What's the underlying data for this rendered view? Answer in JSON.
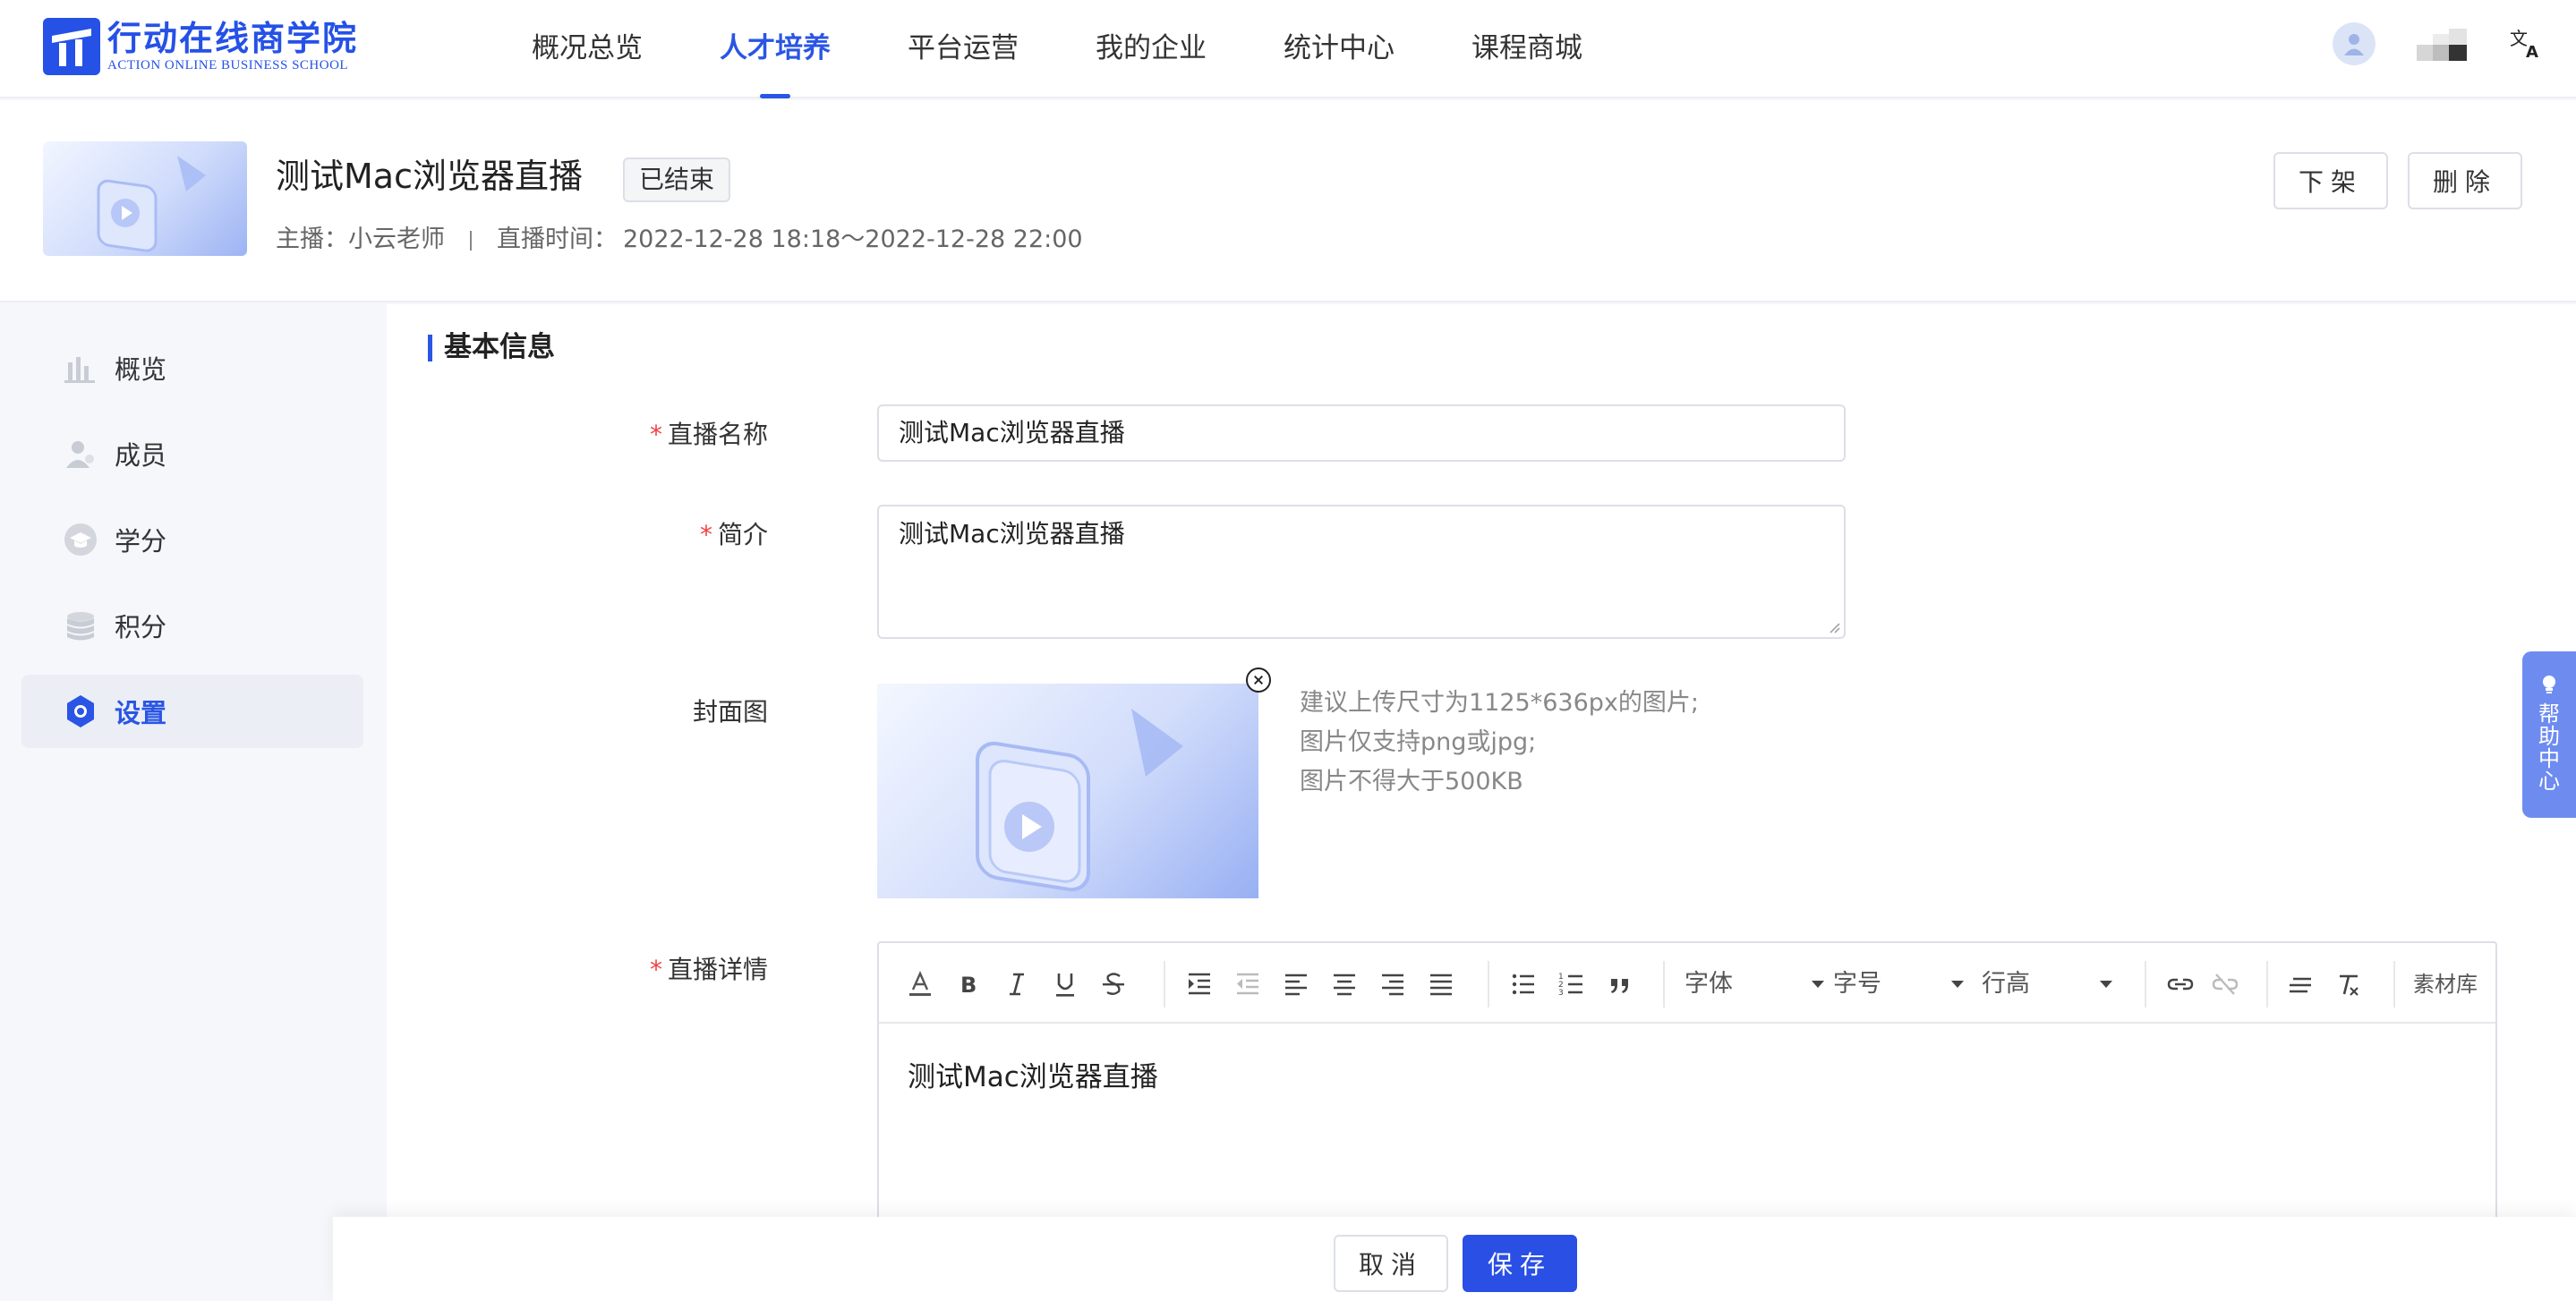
{
  "brand": {
    "name_cn": "行动在线商学院",
    "name_en": "ACTION ONLINE BUSINESS SCHOOL",
    "color": "#2551e6"
  },
  "nav": {
    "items": [
      {
        "label": "概况总览"
      },
      {
        "label": "人才培养"
      },
      {
        "label": "平台运营"
      },
      {
        "label": "我的企业"
      },
      {
        "label": "统计中心"
      },
      {
        "label": "课程商城"
      }
    ],
    "active_index": 1
  },
  "header": {
    "title": "测试Mac浏览器直播",
    "status": "已结束",
    "host_label": "主播：",
    "host": "小云老师",
    "time_label": "直播时间：",
    "time_range": "2022-12-28 18:18～2022-12-28 22:00",
    "unpublish_label": "下架",
    "delete_label": "删除"
  },
  "sidebar": {
    "items": [
      {
        "label": "概览",
        "icon": "bar-chart-icon"
      },
      {
        "label": "成员",
        "icon": "member-icon"
      },
      {
        "label": "学分",
        "icon": "graduation-cap-icon"
      },
      {
        "label": "积分",
        "icon": "coins-icon"
      },
      {
        "label": "设置",
        "icon": "gear-icon"
      }
    ],
    "active_index": 4
  },
  "form": {
    "section_title": "基本信息",
    "name_label": "直播名称",
    "name_value": "测试Mac浏览器直播",
    "intro_label": "简介",
    "intro_value": "测试Mac浏览器直播",
    "cover_label": "封面图",
    "cover_tips": [
      "建议上传尺寸为1125*636px的图片;",
      "图片仅支持png或jpg;",
      "图片不得大于500KB"
    ],
    "detail_label": "直播详情",
    "detail_content": "测试Mac浏览器直播"
  },
  "editor_toolbar": {
    "font_family": "字体",
    "font_size": "字号",
    "line_height": "行高",
    "material_library": "素材库"
  },
  "help": {
    "label": "帮助中心"
  },
  "footer": {
    "cancel_label": "取消",
    "save_label": "保存"
  },
  "colors": {
    "primary": "#2a55e5",
    "required": "#ee4444",
    "help_tab": "#6e8cf0"
  }
}
